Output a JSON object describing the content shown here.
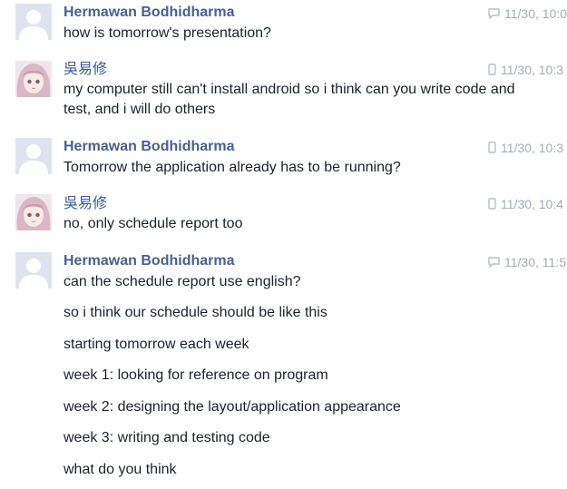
{
  "messages": [
    {
      "sender": "Hermawan Bodhidharma",
      "time": "11/30, 10:0",
      "device": "chat-bubble",
      "text": "how is tomorrow's presentation?"
    },
    {
      "sender": "吳易修",
      "time": "11/30, 10:3",
      "device": "mobile-phone",
      "text": "my computer still can't install android so i think can you write code and test, and i  will do others"
    },
    {
      "sender": "Hermawan Bodhidharma",
      "time": "11/30, 10:3",
      "device": "mobile-phone",
      "text": "Tomorrow the application already has to be running?"
    },
    {
      "sender": "吳易修",
      "time": "11/30, 10:4",
      "device": "mobile-phone",
      "text": "no, only schedule report too"
    },
    {
      "sender": "Hermawan Bodhidharma",
      "time": "11/30, 11:5",
      "device": "chat-bubble",
      "lines": [
        "can the schedule report use english?",
        "so i think our schedule should be like this",
        "starting tomorrow each week",
        "week 1: looking for reference on program",
        "week 2: designing the layout/application appearance",
        "week 3: writing and testing code",
        "what do you think"
      ]
    }
  ],
  "colors": {
    "sender": "#4b5e8f",
    "meta": "#a6abb5",
    "text": "#1d2129"
  }
}
